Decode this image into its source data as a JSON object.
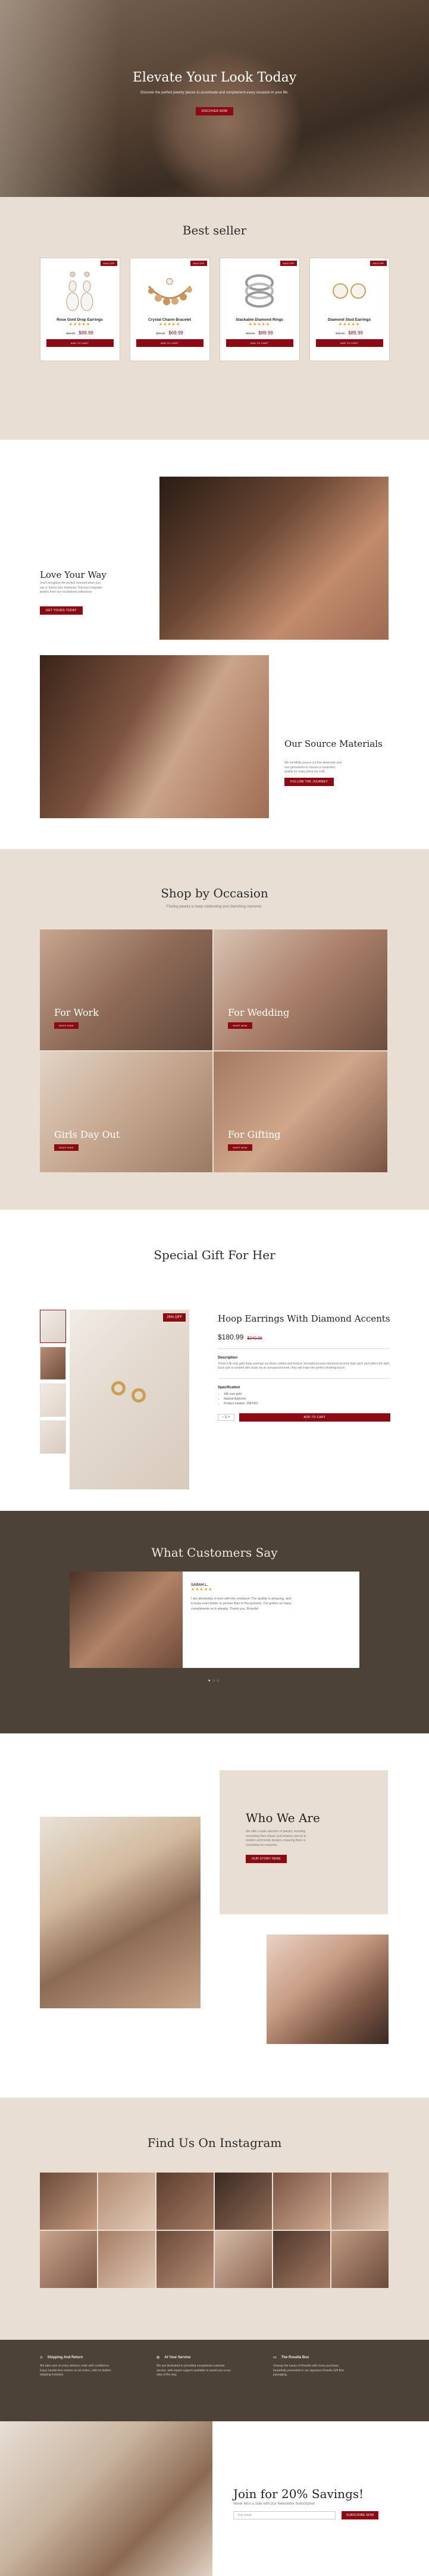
{
  "hero": {
    "title": "Elevate Your Look Today",
    "subtitle": "Discover the perfect jewelry pieces to accentuate and complement every occasion in your life.",
    "button": "Discover Now"
  },
  "bestseller": {
    "title": "Best seller",
    "products": [
      {
        "badge": "SALE OFF",
        "name": "Rose Gold Drop Earrings",
        "stars": "★★★★★",
        "old_price": "$99.00",
        "price": "$89.99",
        "button": "Add to Cart"
      },
      {
        "badge": "SALE OFF",
        "name": "Crystal Charm Bracelet",
        "stars": "★★★★★",
        "old_price": "$89.00",
        "price": "$69.99",
        "button": "Add to Cart"
      },
      {
        "badge": "SALE OFF",
        "name": "Stackable Diamond Rings",
        "stars": "★★★★★",
        "old_price": "$99.00",
        "price": "$89.99",
        "button": "Add to Cart"
      },
      {
        "badge": "SALE OFF",
        "name": "Diamond Stud Earrings",
        "stars": "★★★★★",
        "old_price": "$99.00",
        "price": "$89.99",
        "button": "Add to Cart"
      }
    ]
  },
  "love": {
    "title": "Love Your Way",
    "text": "You'll recognize the perfect moment when you see it. Invest your moments. Discover exquisite jewelry from our exceptional collections.",
    "button": "Get Yours Today",
    "source_title": "Our Source Materials",
    "source_text": "We mindfully source our fine diamonds and rare gemstones to ensure a consistent quality for every piece we craft.",
    "source_button": "Follow the Journey"
  },
  "occasion": {
    "title": "Shop by Occasion",
    "subtitle": "Finding jewelry to keep celebrating and cherishing moments.",
    "items": [
      {
        "label": "For Work",
        "button": "Shop Now"
      },
      {
        "label": "For Wedding",
        "button": "Shop Now"
      },
      {
        "label": "Girls Day Out",
        "button": "Shop Now"
      },
      {
        "label": "For Gifting",
        "button": "Shop Now"
      }
    ]
  },
  "gift": {
    "title": "Special Gift For Her",
    "badge": "25% OFF",
    "name": "Hoop Earrings With Diamond Accents",
    "price": "$180.99",
    "old_price": "$240.00",
    "desc_head": "Description",
    "desc": "These 14k rose gold hoop earrings are finely crafted and feature Sensational pave diamond accents that catch and reflect the light. Each pair is created with studs for an unexpected twist; they will make the perfect finishing touch.",
    "spec_head": "Specification",
    "specs": [
      "14k rose gold",
      "Natural diamond",
      "Product number: 2587301"
    ],
    "qty": "1",
    "button": "Add to Cart"
  },
  "testimonials": {
    "title": "What Customers Say",
    "name": "SARAH L.",
    "stars": "★★★★★",
    "quote": "I am absolutely in love with the necklace! The quality is amazing, and it looks even better in person than in the pictures. I've gotten so many compliments on it already. Thank you, Rosella!",
    "dots": "●○○"
  },
  "who": {
    "title": "Who We Are",
    "text": "We offer a wide selection of jewelry, including everything from classic and timeless pieces to modern and trendy designs, ensuring there is something for everyone.",
    "button": "Our Story Here"
  },
  "instagram": {
    "title": "Find Us On Instagram"
  },
  "services": [
    {
      "icon": "◇",
      "title": "Shipping And Return",
      "text": "We take care of every delivery order with confidence. Enjoy hassle-free returns on all orders, with no hidden shipping included."
    },
    {
      "icon": "◎",
      "title": "At Your Service",
      "text": "We are dedicated to providing exceptional customer service, with expert support available to assist you every step of the way."
    },
    {
      "icon": "▭",
      "title": "The Rosella Box",
      "text": "Unwrap the luxury of Rosella with every purchase, beautifully presented in our signature Rosella Gift Box packaging."
    }
  ],
  "newsletter": {
    "title": "Join for 20% Savings!",
    "subtitle": "Never Miss a Sale with Our Newsletter Subscription",
    "placeholder": "Your email",
    "button": "Subscribe Now"
  }
}
